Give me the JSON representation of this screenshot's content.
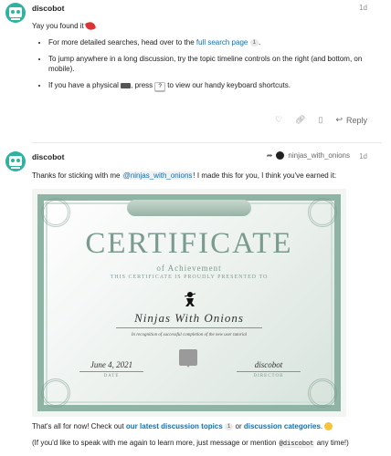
{
  "post1": {
    "username": "discobot",
    "age": "1d",
    "intro": "Yay you found it",
    "bullets": {
      "b1_pre": "For more detailed searches, head over to the ",
      "b1_link": "full search page",
      "b1_badge": "1",
      "b1_post": ".",
      "b2": "To jump anywhere in a long discussion, try the topic timeline controls on the right (and bottom, on mobile).",
      "b3_pre": "If you have a physical ",
      "b3_mid": ", press ",
      "b3_key": "?",
      "b3_post": " to view our handy keyboard shortcuts."
    },
    "reply_label": "Reply"
  },
  "post2": {
    "username": "discobot",
    "reply_to": "ninjas_with_onions",
    "age": "1d",
    "text_pre": "Thanks for sticking with me ",
    "mention": "@ninjas_with_onions",
    "text_post": "! I made this for you, I think you've earned it:",
    "certificate": {
      "title": "CERTIFICATE",
      "subtitle": "of Achievement",
      "presented": "THIS CERTIFICATE IS PROUDLY PRESENTED TO",
      "name": "Ninjas With Onions",
      "recognition": "In recognition of successful completion of the new user tutorial",
      "date": "June 4, 2021",
      "date_label": "DATE",
      "signer": "discobot",
      "signer_label": "DIRECTOR"
    },
    "closing_pre": "That's all for now! Check out ",
    "closing_link1": "our latest discussion topics",
    "closing_badge": "1",
    "closing_mid": " or ",
    "closing_link2": "discussion categories",
    "closing_post": ".",
    "help_pre": "(If you'd like to speak with me again to learn more, just message or mention ",
    "help_mention": "@discobot",
    "help_post": " any time!)"
  },
  "colors": {
    "link": "#0a72b5",
    "avatar": "#2eb3a1",
    "cert_green": "#7a9b8d"
  }
}
